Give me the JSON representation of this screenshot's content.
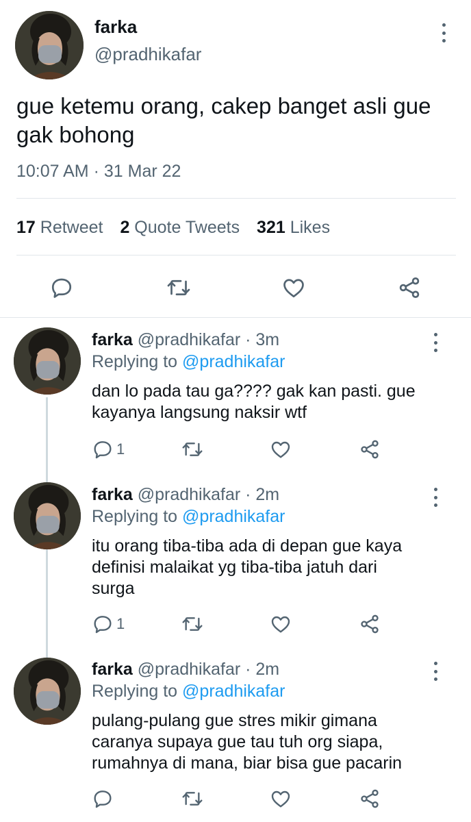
{
  "main_tweet": {
    "display_name": "farka",
    "handle": "@pradhikafar",
    "text_line1": "gue ketemu orang, cakep banget asli gue",
    "text_line2": "gak bohong",
    "time": "10:07 AM",
    "separator": "·",
    "date": "31 Mar 22",
    "stats": {
      "retweets_count": "17",
      "retweets_label": "Retweet",
      "quotes_count": "2",
      "quotes_label": "Quote Tweets",
      "likes_count": "321",
      "likes_label": "Likes"
    }
  },
  "replies": [
    {
      "display_name": "farka",
      "handle_time": "@pradhikafar · 3m",
      "replying_prefix": "Replying to",
      "replying_to": "@pradhikafar",
      "lines": [
        "dan lo pada tau ga???? gak kan pasti. gue",
        "kayanya langsung naksir wtf"
      ],
      "reply_count": "1"
    },
    {
      "display_name": "farka",
      "handle_time": "@pradhikafar · 2m",
      "replying_prefix": "Replying to",
      "replying_to": "@pradhikafar",
      "lines": [
        "itu orang tiba-tiba ada di depan gue kaya",
        "definisi malaikat yg tiba-tiba jatuh dari",
        "surga"
      ],
      "reply_count": "1"
    },
    {
      "display_name": "farka",
      "handle_time": "@pradhikafar · 2m",
      "replying_prefix": "Replying to",
      "replying_to": "@pradhikafar",
      "lines": [
        "pulang-pulang gue stres mikir gimana",
        "caranya supaya gue tau tuh org siapa,",
        "rumahnya di mana, biar bisa gue pacarin"
      ],
      "reply_count": ""
    }
  ],
  "colors": {
    "text": "#0f1419",
    "secondary": "#536471",
    "link": "#1d9bf0",
    "divider": "#e1e6ea"
  },
  "icons": [
    "reply-icon",
    "retweet-icon",
    "like-icon",
    "share-icon",
    "more-icon"
  ]
}
